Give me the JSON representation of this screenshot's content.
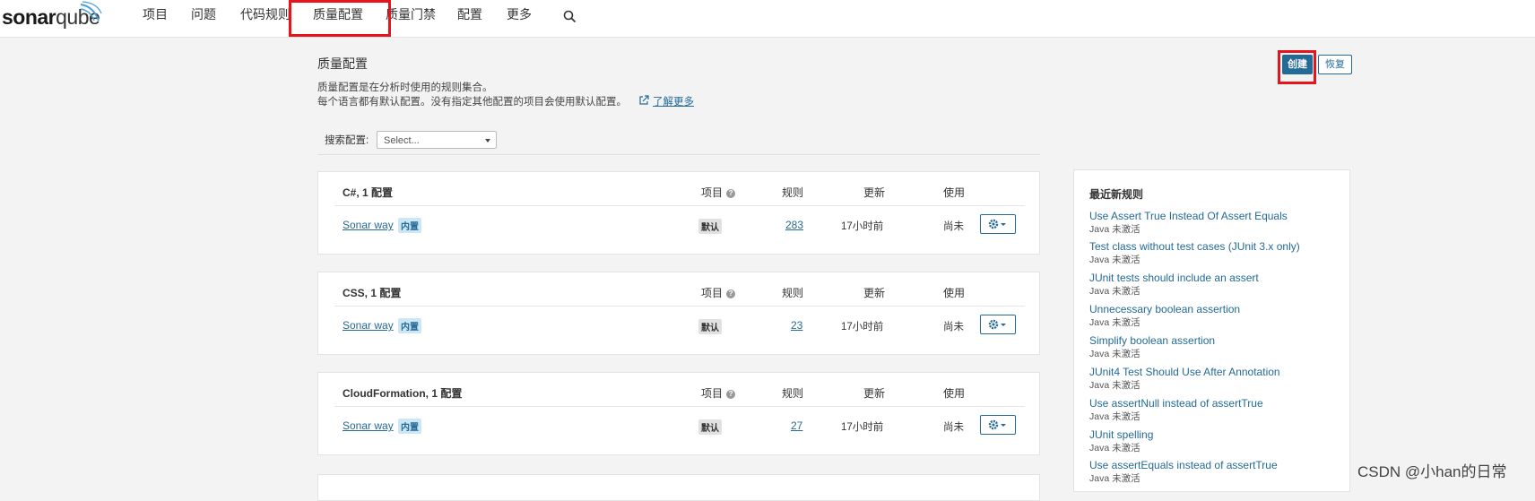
{
  "app": {
    "logo_main": "sonar",
    "logo_q": "qube"
  },
  "nav": {
    "items": [
      "项目",
      "问题",
      "代码规则",
      "质量配置",
      "质量门禁",
      "配置",
      "更多"
    ],
    "search_icon": "search-icon"
  },
  "page": {
    "title": "质量配置",
    "desc_line1": "质量配置是在分析时使用的规则集合。",
    "desc_line2": "每个语言都有默认配置。没有指定其他配置的项目会使用默认配置。",
    "learn_more": "了解更多",
    "create_label": "创建",
    "restore_label": "恢复",
    "search_label": "搜索配置:",
    "select_placeholder": "Select..."
  },
  "table_headers": {
    "projects": "项目",
    "rules": "规则",
    "updated": "更新",
    "used": "使用"
  },
  "profiles": [
    {
      "language_title": "C#, 1 配置",
      "name": "Sonar way",
      "builtin": "内置",
      "default": "默认",
      "rules": "283",
      "updated": "17小时前",
      "used": "尚未"
    },
    {
      "language_title": "CSS, 1 配置",
      "name": "Sonar way",
      "builtin": "内置",
      "default": "默认",
      "rules": "23",
      "updated": "17小时前",
      "used": "尚未"
    },
    {
      "language_title": "CloudFormation, 1 配置",
      "name": "Sonar way",
      "builtin": "内置",
      "default": "默认",
      "rules": "27",
      "updated": "17小时前",
      "used": "尚未"
    }
  ],
  "sidebar": {
    "title": "最近新规则",
    "rules": [
      {
        "name": "Use Assert True Instead Of Assert Equals",
        "meta": "Java 未激活"
      },
      {
        "name": "Test class without test cases (JUnit 3.x only)",
        "meta": "Java 未激活"
      },
      {
        "name": "JUnit tests should include an assert",
        "meta": "Java 未激活"
      },
      {
        "name": "Unnecessary boolean assertion",
        "meta": "Java 未激活"
      },
      {
        "name": "Simplify boolean assertion",
        "meta": "Java 未激活"
      },
      {
        "name": "JUnit4 Test Should Use After Annotation",
        "meta": "Java 未激活"
      },
      {
        "name": "Use assertNull instead of assertTrue",
        "meta": "Java 未激活"
      },
      {
        "name": "JUnit spelling",
        "meta": "Java 未激活"
      },
      {
        "name": "Use assertEquals instead of assertTrue",
        "meta": "Java 未激活"
      }
    ]
  },
  "watermark": "CSDN @小han的日常",
  "colors": {
    "accent": "#236a97",
    "highlight_box": "#e8141b",
    "background": "#f3f3f3"
  }
}
